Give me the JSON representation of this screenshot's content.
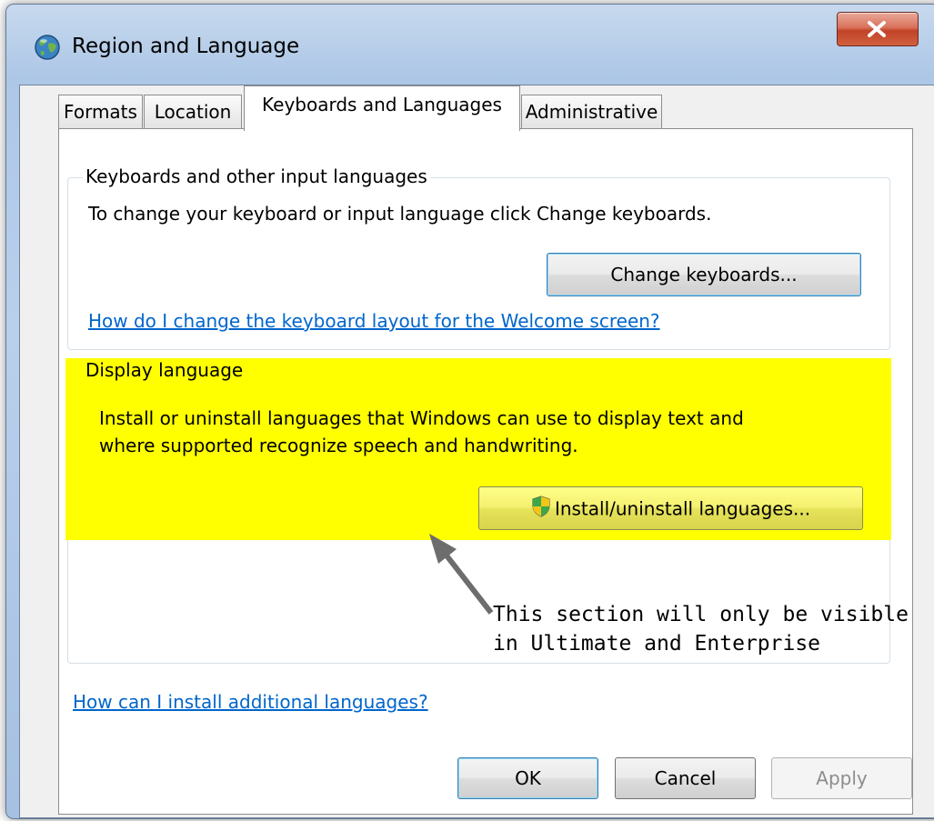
{
  "window": {
    "title": "Region and Language",
    "close_label": "X"
  },
  "tabs": [
    {
      "label": "Formats"
    },
    {
      "label": "Location"
    },
    {
      "label": "Keyboards and Languages"
    },
    {
      "label": "Administrative"
    }
  ],
  "active_tab": "Keyboards and Languages",
  "keyboards_group": {
    "title": "Keyboards and other input languages",
    "description": "To change your keyboard or input language click Change keyboards.",
    "button_label": "Change keyboards...",
    "link": "How do I change the keyboard layout for the Welcome screen?"
  },
  "display_group": {
    "title": "Display language",
    "description_line1": "Install or uninstall languages that Windows can use to display text and",
    "description_line2": "where supported recognize speech and handwriting.",
    "button_label": "Install/uninstall languages..."
  },
  "annotation": {
    "line1": "This section will only be visible",
    "line2": "in Ultimate and Enterprise"
  },
  "footer_link": "How can I install additional languages?",
  "dialog_buttons": {
    "ok": "OK",
    "cancel": "Cancel",
    "apply": "Apply"
  },
  "colors": {
    "highlight": "#ffff00",
    "link": "#0066cc",
    "close_button": "#c14328"
  },
  "icons": {
    "app": "globe-icon",
    "install_button": "uac-shield-icon",
    "annotation": "arrow-icon"
  }
}
